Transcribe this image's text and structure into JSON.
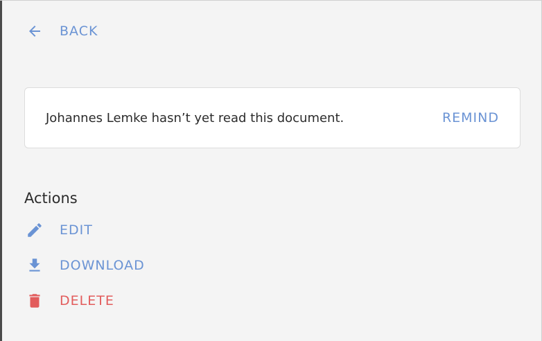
{
  "nav": {
    "back_label": "BACK",
    "back_icon": "arrow-left-icon"
  },
  "notice": {
    "text": "Johannes Lemke hasn’t yet read this document.",
    "remind_label": "REMIND"
  },
  "actions": {
    "heading": "Actions",
    "items": [
      {
        "label": "EDIT",
        "icon": "pencil-icon",
        "color": "#6a93d4"
      },
      {
        "label": "DOWNLOAD",
        "icon": "download-icon",
        "color": "#6a93d4"
      },
      {
        "label": "DELETE",
        "icon": "trash-icon",
        "color": "#e25c5c"
      }
    ]
  },
  "colors": {
    "accent": "#6a93d4",
    "danger": "#e25c5c",
    "background": "#f4f4f4",
    "card": "#ffffff",
    "text": "#2b2b2b"
  }
}
